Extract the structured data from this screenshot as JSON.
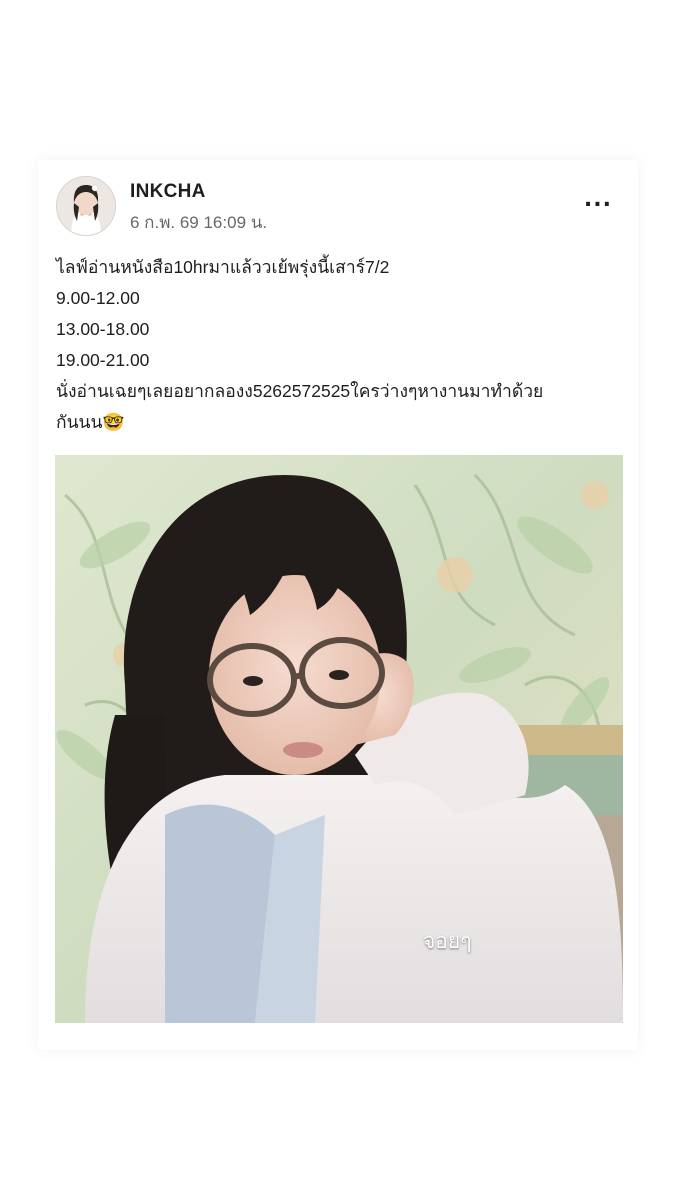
{
  "post": {
    "author": "INKCHA",
    "timestamp": "6 ก.พ. 69 16:09 น.",
    "more_label": "...",
    "lines": [
      "ไลฟ์อ่านหนังสือ10hrมาแล้ววเย้พรุ่งนี้เสาร์7/2",
      "9.00-12.00",
      "13.00-18.00",
      "19.00-21.00",
      "นั่งอ่านเฉยๆเลยอยากลองง5262572525ใครว่างๆหางานมาทำด้วย",
      "กันนน🤓"
    ],
    "photo": {
      "caption": "จอยๆ"
    }
  }
}
